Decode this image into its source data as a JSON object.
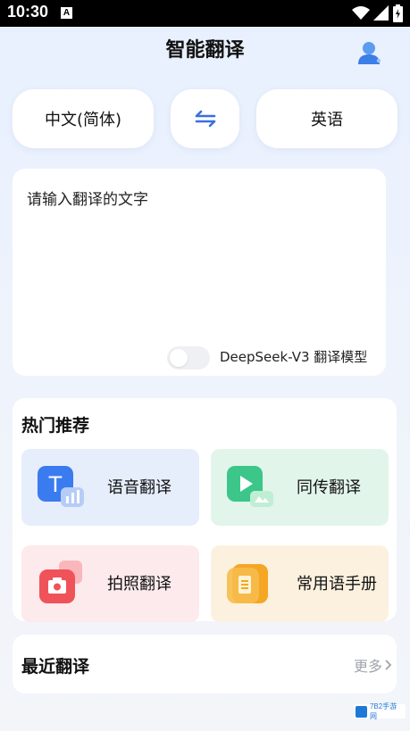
{
  "status_bar": {
    "time": "10:30",
    "notification_glyph": "A"
  },
  "header": {
    "title": "智能翻译",
    "profile_icon": "user-icon"
  },
  "language": {
    "source": "中文(简体)",
    "target": "英语",
    "swap_icon": "swap-arrows-icon"
  },
  "input": {
    "placeholder": "请输入翻译的文字",
    "model_label": "DeepSeek-V3 翻译模型",
    "model_enabled": false
  },
  "hot": {
    "title": "热门推荐",
    "items": [
      {
        "label": "语音翻译",
        "icon": "voice-translate-icon",
        "color": "#3a7bf0"
      },
      {
        "label": "同传翻译",
        "icon": "play-icon",
        "color": "#3cc68a"
      },
      {
        "label": "拍照翻译",
        "icon": "camera-icon",
        "color": "#f0525a"
      },
      {
        "label": "常用语手册",
        "icon": "book-icon",
        "color": "#f5a623"
      }
    ]
  },
  "recent": {
    "title": "最近翻译",
    "more": "更多"
  },
  "watermark": {
    "text": "7B2手游网"
  }
}
